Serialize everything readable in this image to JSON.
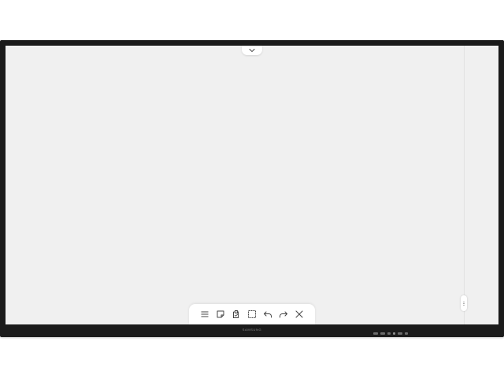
{
  "device": {
    "brand_label": "SAMSUNG"
  },
  "colors": {
    "bezel": "#1b1b1b",
    "canvas": "#f0f0f0",
    "panel": "#ffffff",
    "icon": "#444444"
  },
  "handles": {
    "top_icon": "chevron-down-icon",
    "side_icon": "grip-icon"
  },
  "toolbar": {
    "tools": [
      {
        "id": "menu",
        "icon": "menu-icon"
      },
      {
        "id": "note",
        "icon": "sticky-note-icon"
      },
      {
        "id": "import",
        "icon": "import-document-icon"
      },
      {
        "id": "select",
        "icon": "select-area-icon"
      },
      {
        "id": "undo",
        "icon": "undo-icon"
      },
      {
        "id": "redo",
        "icon": "redo-icon"
      },
      {
        "id": "close",
        "icon": "close-icon"
      }
    ]
  },
  "bezel_buttons": [
    "hw-button",
    "hw-button",
    "hw-button",
    "hw-button",
    "hw-button",
    "hw-button"
  ]
}
